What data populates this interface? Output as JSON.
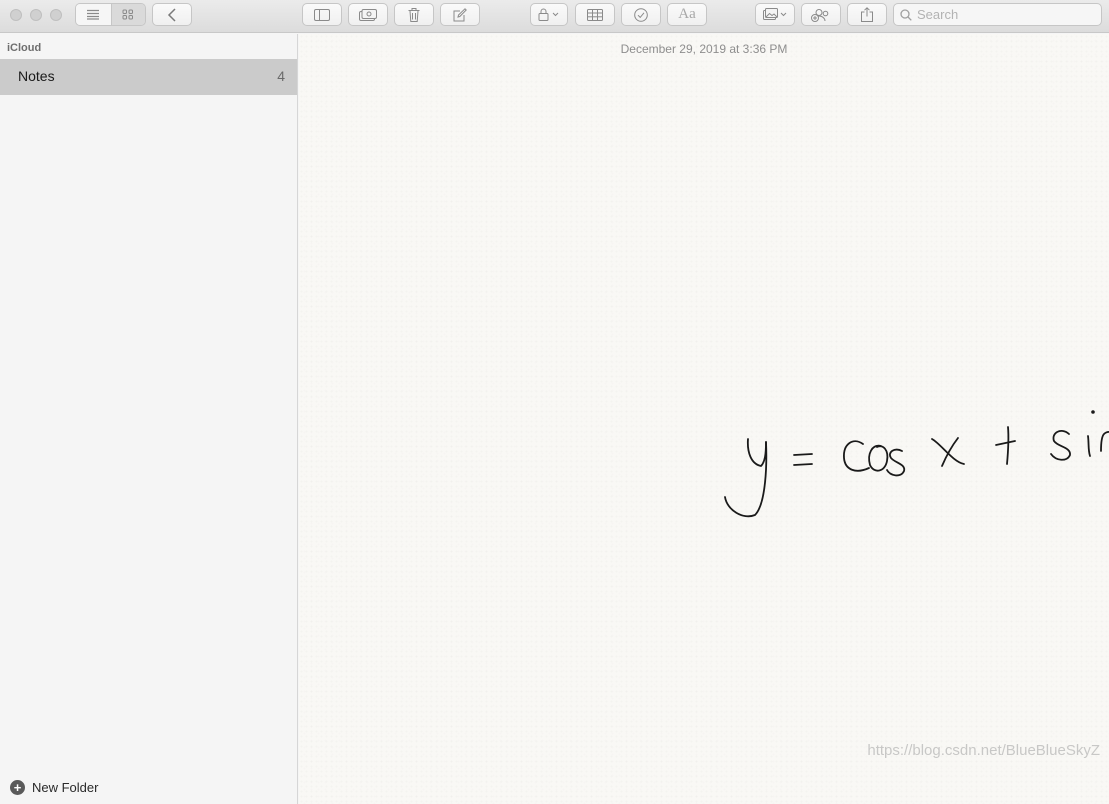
{
  "toolbar": {
    "search_placeholder": "Search",
    "font_button_label": "Aa"
  },
  "sidebar": {
    "account": "iCloud",
    "folders": [
      {
        "name": "Notes",
        "count": "4"
      }
    ],
    "new_folder_label": "New Folder"
  },
  "note": {
    "date": "December 29, 2019 at 3:36 PM",
    "handwriting": "y = cos x + sin y"
  },
  "watermark": "https://blog.csdn.net/BlueBlueSkyZ",
  "colors": {
    "selected_folder": "#cbcbcb",
    "paper": "#f9f8f5",
    "ink": "#1a1a1a"
  }
}
